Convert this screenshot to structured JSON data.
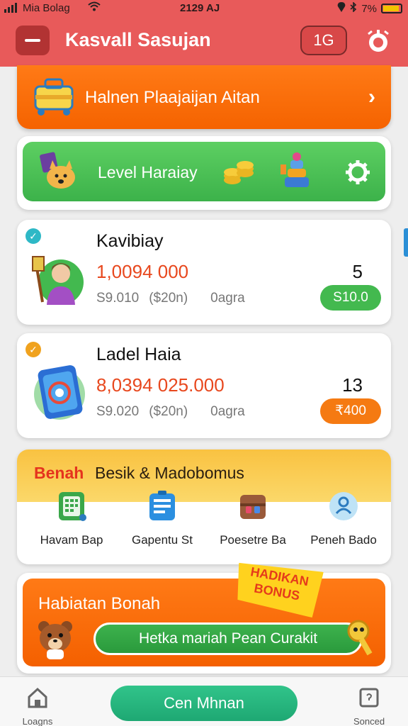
{
  "status_bar": {
    "carrier": "Mia Bolag",
    "time": "2129 AJ",
    "battery": "7%"
  },
  "header": {
    "title": "Kasvall Sasujan",
    "level_badge": "1G"
  },
  "banner": {
    "text": "Halnen Plaajaijan Aitan"
  },
  "level_card": {
    "text": "Level Haraiay"
  },
  "items": [
    {
      "name": "Kavibiay",
      "amount": "1,0094 000",
      "price": "S9.010",
      "sub": "($20n)",
      "status": "0agra",
      "count": "5",
      "button": "S10.0",
      "accent": "#43b94f",
      "badge_color": "#2eb8c6"
    },
    {
      "name": "Ladel Haia",
      "amount": "8,0394 025.000",
      "price": "S9.020",
      "sub": "($20n)",
      "status": "0agra",
      "count": "13",
      "button": "₹400",
      "accent": "#f57a12",
      "badge_color": "#f0a21e"
    }
  ],
  "bonus_section": {
    "tag": "Benah",
    "title": "Besik & Madobomus",
    "features": [
      {
        "label": "Havam Bap",
        "icon": "calculator-icon"
      },
      {
        "label": "Gapentu St",
        "icon": "notepad-icon"
      },
      {
        "label": "Poesetre Ba",
        "icon": "treasure-chest-icon"
      },
      {
        "label": "Peneh Bado",
        "icon": "person-badge-icon"
      }
    ]
  },
  "promo": {
    "title": "Habiatan Bonah",
    "badge": "HADIKAN BONUS",
    "cta": "Hetka mariah Pean Curakit"
  },
  "bottom_nav": {
    "home_label": "Loagns",
    "main_label": "Cen Mhnan",
    "right_label": "Sonced"
  },
  "colors": {
    "header_red": "#e85a5a",
    "orange": "#f56300",
    "green": "#3cb24a",
    "amount_red": "#e8481e"
  }
}
